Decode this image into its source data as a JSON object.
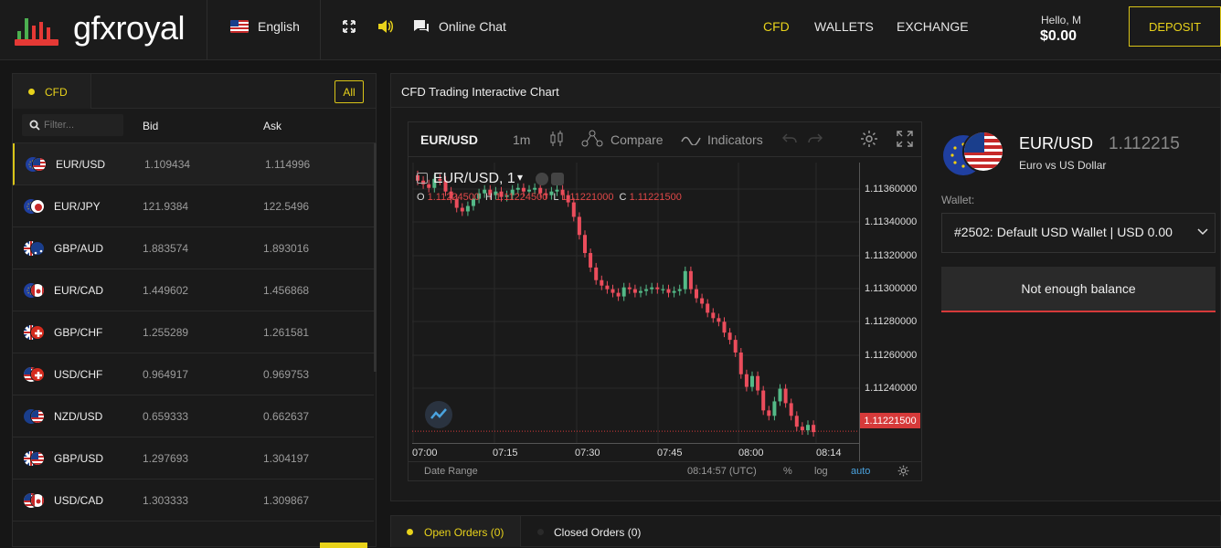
{
  "brand": {
    "name": "gfxroyal"
  },
  "topbar": {
    "language": "English",
    "chat": "Online Chat",
    "nav": [
      "CFD",
      "WALLETS",
      "EXCHANGE"
    ],
    "greeting": "Hello, M",
    "balance": "$0.00",
    "deposit": "DEPOSIT"
  },
  "market": {
    "tab": "CFD",
    "all_button": "All",
    "filter_placeholder": "Filter...",
    "col_bid": "Bid",
    "col_ask": "Ask",
    "rows": [
      {
        "pair": "EUR/USD",
        "bid": "1.109434",
        "ask": "1.114996"
      },
      {
        "pair": "EUR/JPY",
        "bid": "121.9384",
        "ask": "122.5496"
      },
      {
        "pair": "GBP/AUD",
        "bid": "1.883574",
        "ask": "1.893016"
      },
      {
        "pair": "EUR/CAD",
        "bid": "1.449602",
        "ask": "1.456868"
      },
      {
        "pair": "GBP/CHF",
        "bid": "1.255289",
        "ask": "1.261581"
      },
      {
        "pair": "USD/CHF",
        "bid": "0.964917",
        "ask": "0.969753"
      },
      {
        "pair": "NZD/USD",
        "bid": "0.659333",
        "ask": "0.662637"
      },
      {
        "pair": "GBP/USD",
        "bid": "1.297693",
        "ask": "1.304197"
      },
      {
        "pair": "USD/CAD",
        "bid": "1.303333",
        "ask": "1.309867"
      }
    ]
  },
  "chart_panel": {
    "title": "CFD Trading Interactive Chart"
  },
  "chart_toolbar": {
    "symbol": "EUR/USD",
    "interval": "1m",
    "compare": "Compare",
    "indicators": "Indicators"
  },
  "chart_legend": {
    "symbol": "EUR/USD, 1",
    "o_label": "O",
    "o": "1.11224500",
    "h_label": "H",
    "h": "1.11224500",
    "l_label": "L",
    "l": "1.11221000",
    "c_label": "C",
    "c": "1.11221500"
  },
  "chart_footer": {
    "date_range": "Date Range",
    "time": "08:14:57 (UTC)",
    "pct": "%",
    "log": "log",
    "auto": "auto"
  },
  "chart_data": {
    "type": "candlestick",
    "y_ticks": [
      "1.11360000",
      "1.11340000",
      "1.11320000",
      "1.11300000",
      "1.11280000",
      "1.11260000",
      "1.11240000"
    ],
    "x_ticks": [
      "07:00",
      "07:15",
      "07:30",
      "07:45",
      "08:00",
      "08:14"
    ],
    "ylim": [
      1.11215,
      1.1137
    ],
    "last_price": "1.11221500",
    "up_color": "#53b987",
    "down_color": "#eb4d5c",
    "closes": [
      1.1136,
      1.11358,
      1.11356,
      1.11361,
      1.1136,
      1.11354,
      1.1135,
      1.11345,
      1.11343,
      1.11346,
      1.1135,
      1.11353,
      1.11355,
      1.11352,
      1.11354,
      1.11351,
      1.11352,
      1.11355,
      1.11356,
      1.11354,
      1.11355,
      1.11356,
      1.11353,
      1.11352,
      1.11354,
      1.11355,
      1.11352,
      1.11348,
      1.1134,
      1.1133,
      1.1132,
      1.11312,
      1.11305,
      1.11302,
      1.113,
      1.11298,
      1.11296,
      1.11301,
      1.113,
      1.11298,
      1.11299,
      1.113,
      1.11301,
      1.113,
      1.113,
      1.11298,
      1.11299,
      1.113,
      1.1131,
      1.113,
      1.11295,
      1.11292,
      1.11287,
      1.11284,
      1.11282,
      1.11276,
      1.11272,
      1.11265,
      1.11253,
      1.11246,
      1.11252,
      1.11244,
      1.11233,
      1.1123,
      1.11238,
      1.11245,
      1.11237,
      1.1123,
      1.11224,
      1.11222,
      1.11225,
      1.11221
    ]
  },
  "instrument": {
    "pair": "EUR/USD",
    "price": "1.112215",
    "desc": "Euro vs US Dollar",
    "wallet_label": "Wallet:",
    "wallet_value": "#2502: Default USD Wallet | USD 0.00",
    "balance_button": "Not enough balance"
  },
  "orders": {
    "open": "Open Orders (0)",
    "closed": "Closed Orders (0)"
  },
  "colors": {
    "accent": "#e8d21b",
    "bg": "#161616",
    "panel": "#1a1a1a"
  }
}
